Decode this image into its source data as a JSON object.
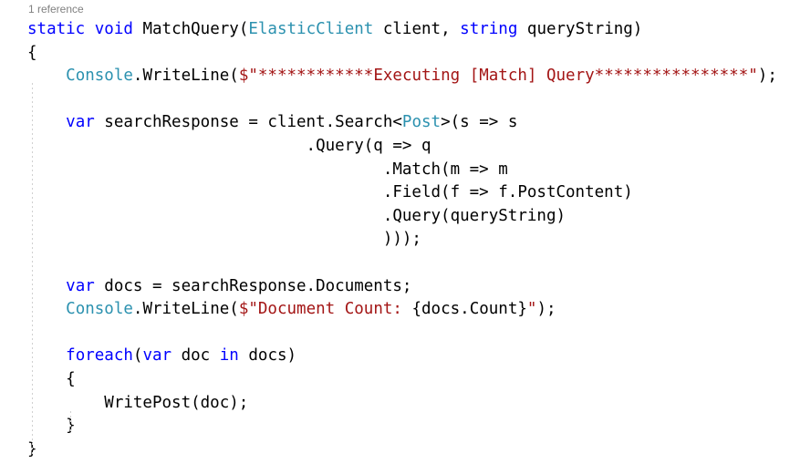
{
  "colors": {
    "background": "#ffffff",
    "keyword": "#0000ff",
    "type": "#2b91af",
    "string": "#a31515",
    "plain": "#000000",
    "codelens": "#808080",
    "indent_guide": "#d0d0d0"
  },
  "codelens": {
    "label": "1 reference"
  },
  "code": {
    "language": "csharp",
    "lines": [
      {
        "segments": [
          {
            "text": "static",
            "style": "keyword"
          },
          {
            "text": " ",
            "style": "plain"
          },
          {
            "text": "void",
            "style": "keyword"
          },
          {
            "text": " MatchQuery(",
            "style": "plain"
          },
          {
            "text": "ElasticClient",
            "style": "type"
          },
          {
            "text": " client, ",
            "style": "plain"
          },
          {
            "text": "string",
            "style": "keyword"
          },
          {
            "text": " queryString)",
            "style": "plain"
          }
        ]
      },
      {
        "segments": [
          {
            "text": "{",
            "style": "plain"
          }
        ]
      },
      {
        "segments": [
          {
            "text": "    ",
            "style": "plain"
          },
          {
            "text": "Console",
            "style": "type"
          },
          {
            "text": ".WriteLine(",
            "style": "plain"
          },
          {
            "text": "$\"************Executing [Match] Query****************\"",
            "style": "string"
          },
          {
            "text": ");",
            "style": "plain"
          }
        ]
      },
      {
        "segments": []
      },
      {
        "segments": [
          {
            "text": "    ",
            "style": "plain"
          },
          {
            "text": "var",
            "style": "keyword"
          },
          {
            "text": " searchResponse = client.Search<",
            "style": "plain"
          },
          {
            "text": "Post",
            "style": "type"
          },
          {
            "text": ">(s => s",
            "style": "plain"
          }
        ]
      },
      {
        "segments": [
          {
            "text": "                             .Query(q => q",
            "style": "plain"
          }
        ]
      },
      {
        "segments": [
          {
            "text": "                                     .Match(m => m",
            "style": "plain"
          }
        ]
      },
      {
        "segments": [
          {
            "text": "                                     .Field(f => f.PostContent)",
            "style": "plain"
          }
        ]
      },
      {
        "segments": [
          {
            "text": "                                     .Query(queryString)",
            "style": "plain"
          }
        ]
      },
      {
        "segments": [
          {
            "text": "                                     )));",
            "style": "plain"
          }
        ]
      },
      {
        "segments": []
      },
      {
        "segments": [
          {
            "text": "    ",
            "style": "plain"
          },
          {
            "text": "var",
            "style": "keyword"
          },
          {
            "text": " docs = searchResponse.Documents;",
            "style": "plain"
          }
        ]
      },
      {
        "segments": [
          {
            "text": "    ",
            "style": "plain"
          },
          {
            "text": "Console",
            "style": "type"
          },
          {
            "text": ".WriteLine(",
            "style": "plain"
          },
          {
            "text": "$\"Document Count: ",
            "style": "string"
          },
          {
            "text": "{docs.Count}",
            "style": "plain"
          },
          {
            "text": "\"",
            "style": "string"
          },
          {
            "text": ");",
            "style": "plain"
          }
        ]
      },
      {
        "segments": []
      },
      {
        "segments": [
          {
            "text": "    ",
            "style": "plain"
          },
          {
            "text": "foreach",
            "style": "keyword"
          },
          {
            "text": "(",
            "style": "plain"
          },
          {
            "text": "var",
            "style": "keyword"
          },
          {
            "text": " doc ",
            "style": "plain"
          },
          {
            "text": "in",
            "style": "keyword"
          },
          {
            "text": " docs)",
            "style": "plain"
          }
        ]
      },
      {
        "segments": [
          {
            "text": "    {",
            "style": "plain"
          }
        ]
      },
      {
        "segments": [
          {
            "text": "        WritePost(doc);",
            "style": "plain"
          }
        ]
      },
      {
        "segments": [
          {
            "text": "    }",
            "style": "plain"
          }
        ]
      },
      {
        "segments": [
          {
            "text": "}",
            "style": "plain"
          }
        ]
      }
    ]
  }
}
